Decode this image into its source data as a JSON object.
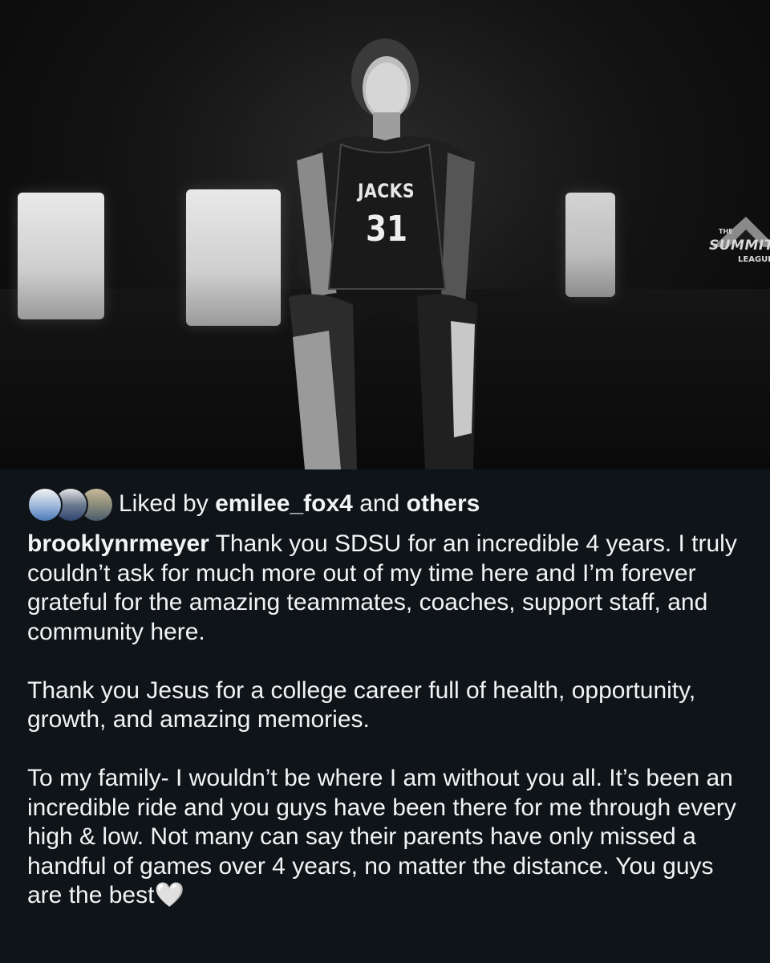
{
  "photo": {
    "jersey_team": "JACKS",
    "jersey_number": "31",
    "logo_the": "THE",
    "logo_text": "SUMMIT",
    "logo_sub": "LEAGUE"
  },
  "likes": {
    "prefix": "Liked by",
    "user": "emilee_fox4",
    "conjunction": "and",
    "others": "others"
  },
  "post": {
    "username": "brooklynrmeyer",
    "paragraphs": [
      "Thank you SDSU for an incredible 4 years. I truly couldn’t ask for much more out of my time here and I’m forever grateful for the amazing teammates, coaches, support staff, and community here.",
      "Thank you Jesus for a college career full of health, opportunity, growth, and amazing memories.",
      "To my family- I wouldn’t be where I am without you all. It’s been an incredible ride and you guys have been there for me through every high & low. Not many can say their parents have only missed a handful of games over 4 years, no matter the distance. You guys are the best🤍"
    ]
  },
  "colors": {
    "background": "#0f1418",
    "text": "#f2f3f5"
  },
  "icons": [
    "heart-white-icon"
  ]
}
